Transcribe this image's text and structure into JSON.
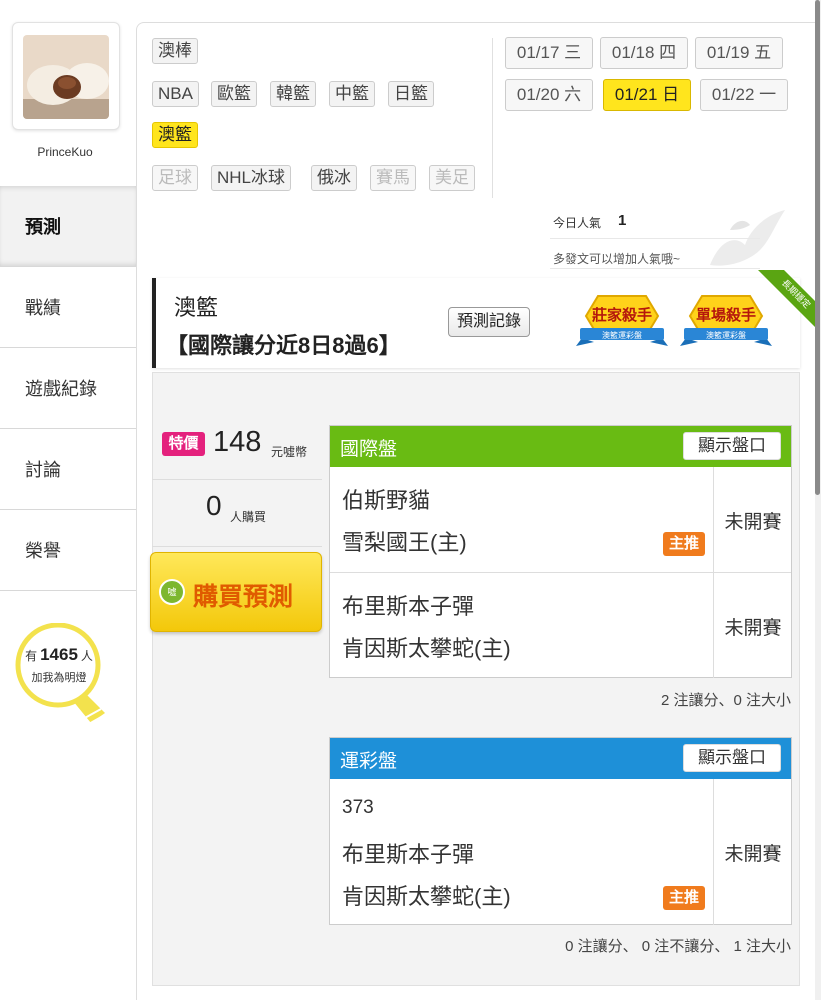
{
  "profile": {
    "username": "PrinceKuo"
  },
  "nav": [
    {
      "label": "預測",
      "active": true
    },
    {
      "label": "戰績"
    },
    {
      "label": "遊戲紀錄"
    },
    {
      "label": "討論"
    },
    {
      "label": "榮譽"
    }
  ],
  "fans": {
    "prefix": "有",
    "count": "1465",
    "suffix": "人",
    "label": "加我為明燈"
  },
  "sports": {
    "row1": [
      "澳棒"
    ],
    "row2": [
      "NBA",
      "歐籃",
      "韓籃",
      "中籃",
      "日籃"
    ],
    "row3": [
      "澳籃"
    ],
    "row4": [
      "足球",
      "NHL冰球",
      "俄冰",
      "賽馬",
      "美足"
    ]
  },
  "dates": [
    {
      "date": "01/17",
      "day": "三"
    },
    {
      "date": "01/18",
      "day": "四"
    },
    {
      "date": "01/19",
      "day": "五"
    },
    {
      "date": "01/20",
      "day": "六"
    },
    {
      "date": "01/21",
      "day": "日",
      "active": true
    },
    {
      "date": "01/22",
      "day": "一"
    }
  ],
  "popularity": {
    "label": "今日人氣",
    "value": "1",
    "hint": "多發文可以增加人氣哦~"
  },
  "header": {
    "title": "澳籃",
    "subtitle": "【國際讓分近8日8過6】",
    "record_button": "預測記錄",
    "badges": [
      {
        "title": "莊家殺手",
        "sub": "澳籃運彩盤"
      },
      {
        "title": "單場殺手",
        "sub": "澳籃運彩盤"
      }
    ],
    "ribbon": "長期穩定"
  },
  "purchase": {
    "badge": "特價",
    "price": "148",
    "unit": "元噓幣",
    "buyers": "0",
    "buyers_label": "人購買",
    "button": "購買預測",
    "button_icon": "噓"
  },
  "international": {
    "title": "國際盤",
    "show_button": "顯示盤口",
    "matches": [
      {
        "away": "伯斯野貓",
        "home": "雪梨國王(主)",
        "status": "未開賽",
        "pick": "主推"
      },
      {
        "away": "布里斯本子彈",
        "home": "肯因斯太攀蛇(主)",
        "status": "未開賽"
      }
    ],
    "summary": "2 注讓分、0 注大小"
  },
  "sportslottery": {
    "title": "運彩盤",
    "show_button": "顯示盤口",
    "matches": [
      {
        "num": "373",
        "away": "布里斯本子彈",
        "home": "肯因斯太攀蛇(主)",
        "status": "未開賽",
        "pick": "主推"
      }
    ],
    "summary": "0 注讓分、 0 注不讓分、 1 注大小"
  }
}
